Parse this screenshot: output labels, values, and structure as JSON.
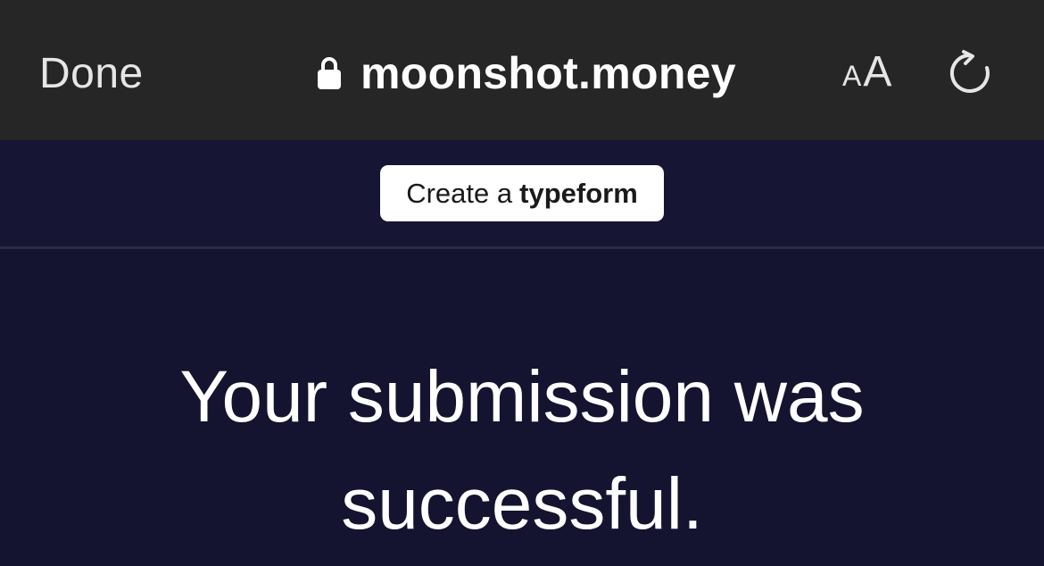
{
  "browser_bar": {
    "done_label": "Done",
    "url": "moonshot.money",
    "text_size_small": "A",
    "text_size_large": "A"
  },
  "banner": {
    "cta_prefix": "Create a",
    "cta_brand": "typeform"
  },
  "main": {
    "message_line1": "Your submission was",
    "message_line2": "successful."
  },
  "colors": {
    "toolbar_bg": "#262626",
    "page_bg": "#141330",
    "button_bg": "#ffffff"
  },
  "icons": [
    "lock-icon",
    "reload-icon"
  ]
}
